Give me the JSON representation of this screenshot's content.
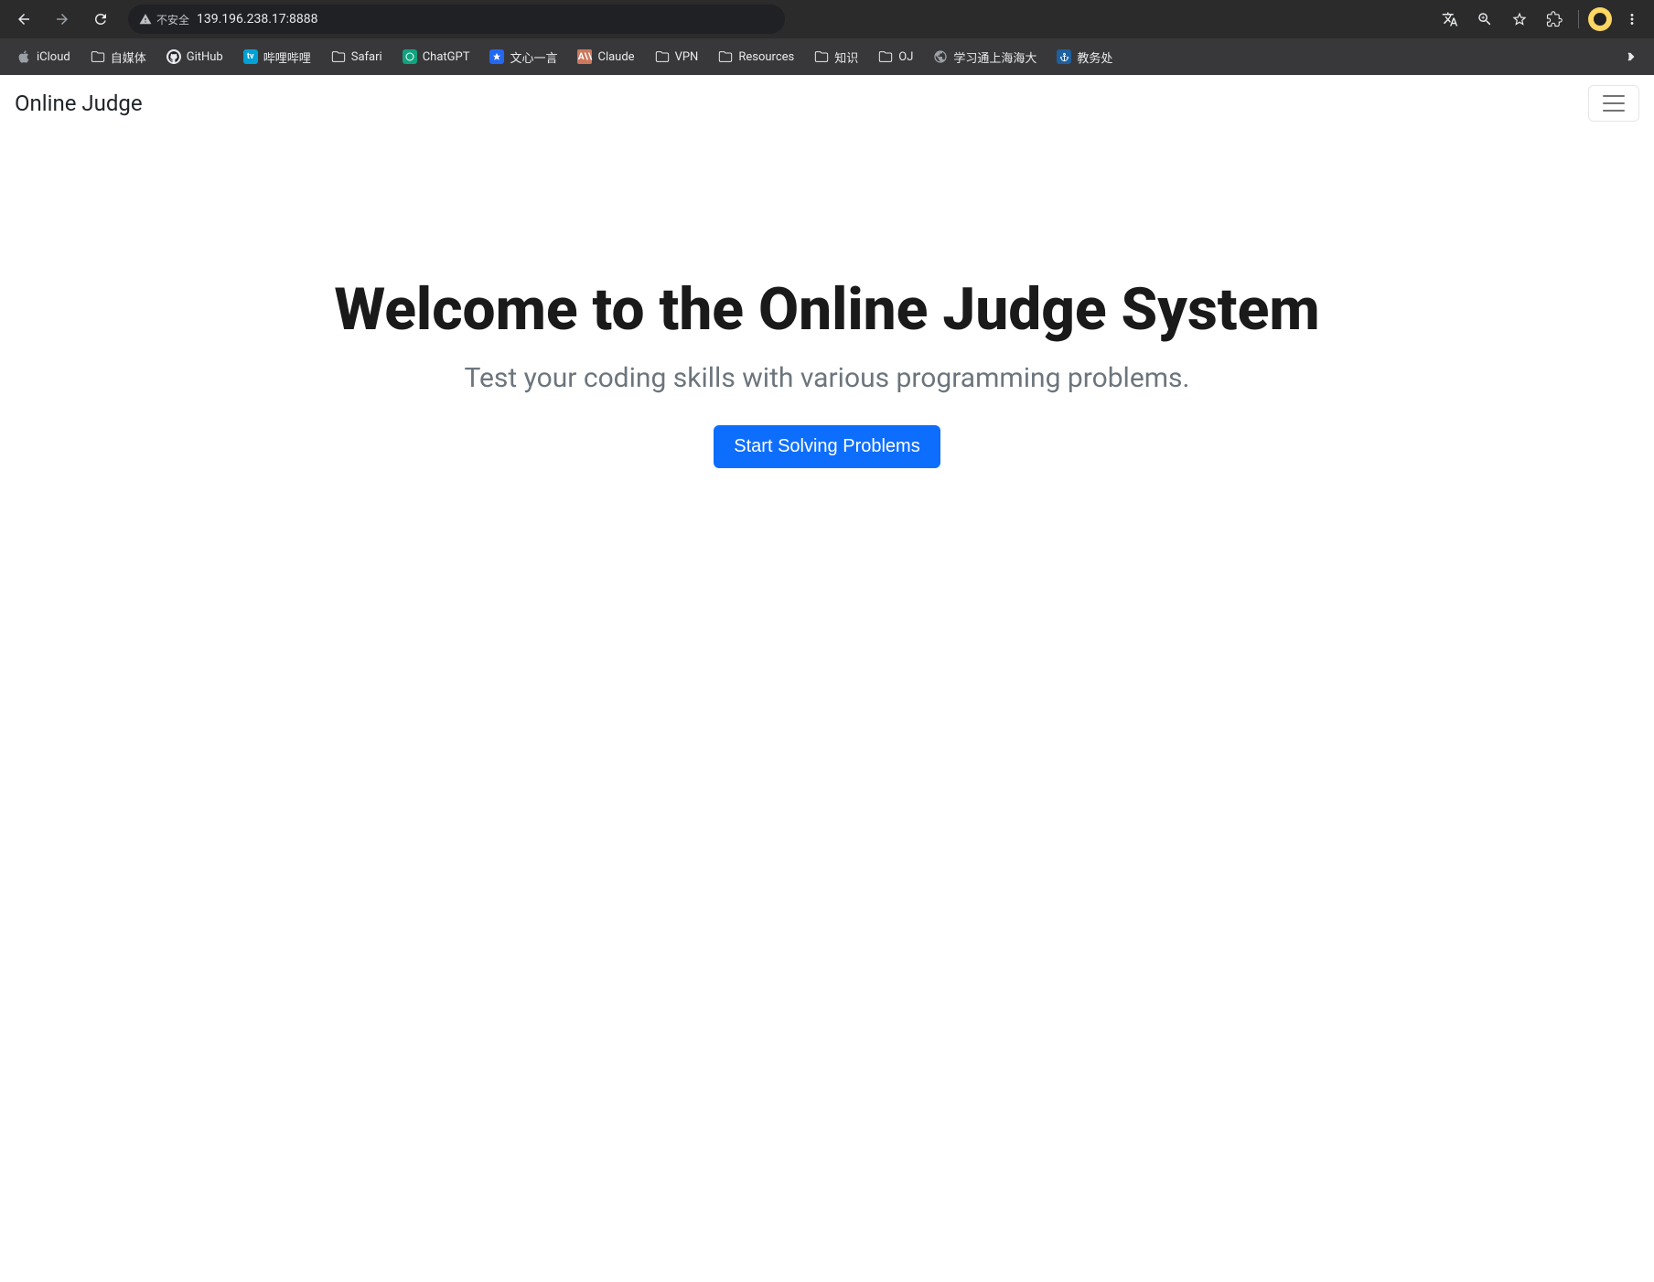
{
  "browser": {
    "security_label": "不安全",
    "url": "139.196.238.17:8888"
  },
  "bookmarks": [
    {
      "icon": "apple",
      "label": "iCloud"
    },
    {
      "icon": "folder",
      "label": "自媒体"
    },
    {
      "icon": "github",
      "label": "GitHub"
    },
    {
      "icon": "bilibili",
      "label": "哔哩哔哩"
    },
    {
      "icon": "folder",
      "label": "Safari"
    },
    {
      "icon": "chatgpt",
      "label": "ChatGPT"
    },
    {
      "icon": "wenxin",
      "label": "文心一言"
    },
    {
      "icon": "claude",
      "label": "Claude"
    },
    {
      "icon": "folder",
      "label": "VPN"
    },
    {
      "icon": "folder",
      "label": "Resources"
    },
    {
      "icon": "folder",
      "label": "知识"
    },
    {
      "icon": "folder",
      "label": "OJ"
    },
    {
      "icon": "globe",
      "label": "学习通上海海大"
    },
    {
      "icon": "anchor",
      "label": "教务处"
    }
  ],
  "page": {
    "navbar_brand": "Online Judge",
    "hero_title": "Welcome to the Online Judge System",
    "hero_subtitle": "Test your coding skills with various programming problems.",
    "cta_label": "Start Solving Problems"
  },
  "colors": {
    "primary": "#0d6efd",
    "muted": "#6c757d"
  }
}
